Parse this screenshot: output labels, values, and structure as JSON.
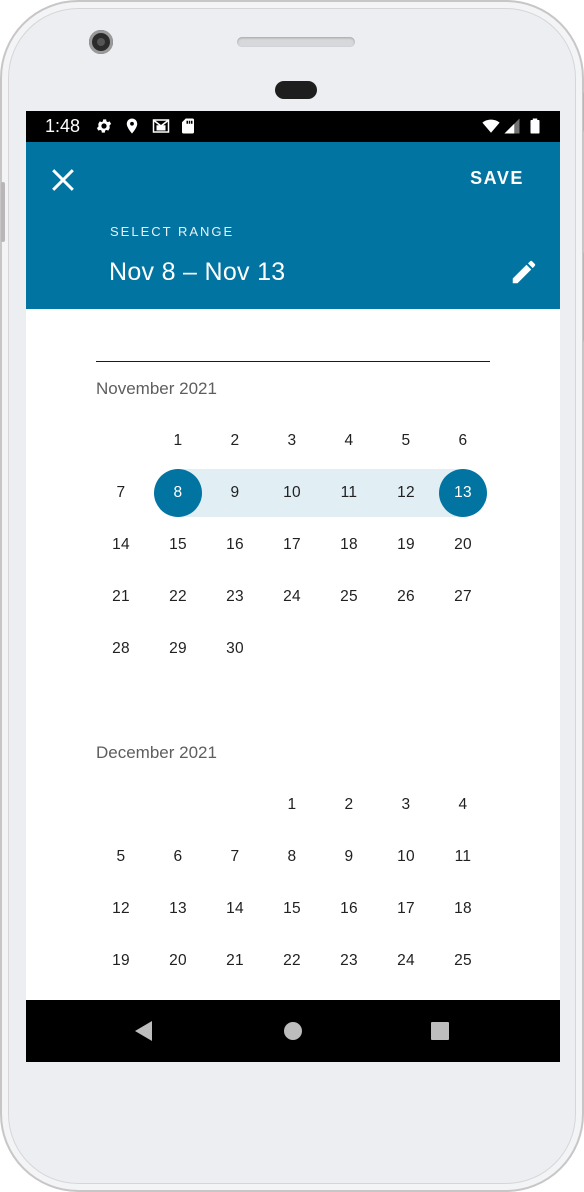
{
  "status_bar": {
    "time": "1:48",
    "left_icons": [
      "settings-icon",
      "location-icon",
      "gmail-icon",
      "sd-card-icon"
    ],
    "right_icons": [
      "wifi-icon",
      "signal-icon",
      "battery-icon"
    ]
  },
  "header": {
    "save_label": "SAVE",
    "select_range_label": "SELECT RANGE",
    "range_title": "Nov 8 – Nov 13",
    "background_color": "#0174a1"
  },
  "selection": {
    "start": "8",
    "end": "13",
    "month": "November 2021"
  },
  "months": [
    {
      "label": "November 2021",
      "weeks": [
        [
          "",
          "1",
          "2",
          "3",
          "4",
          "5",
          "6"
        ],
        [
          "7",
          "8",
          "9",
          "10",
          "11",
          "12",
          "13"
        ],
        [
          "14",
          "15",
          "16",
          "17",
          "18",
          "19",
          "20"
        ],
        [
          "21",
          "22",
          "23",
          "24",
          "25",
          "26",
          "27"
        ],
        [
          "28",
          "29",
          "30",
          "",
          "",
          "",
          ""
        ]
      ]
    },
    {
      "label": "December 2021",
      "weeks": [
        [
          "",
          "",
          "",
          "1",
          "2",
          "3",
          "4"
        ],
        [
          "5",
          "6",
          "7",
          "8",
          "9",
          "10",
          "11"
        ],
        [
          "12",
          "13",
          "14",
          "15",
          "16",
          "17",
          "18"
        ],
        [
          "19",
          "20",
          "21",
          "22",
          "23",
          "24",
          "25"
        ]
      ]
    }
  ],
  "nav_bar": {
    "icons": [
      "back-icon",
      "home-icon",
      "recents-icon"
    ]
  },
  "colors": {
    "accent": "#0174a1",
    "range_fill": "#e1eef4"
  }
}
